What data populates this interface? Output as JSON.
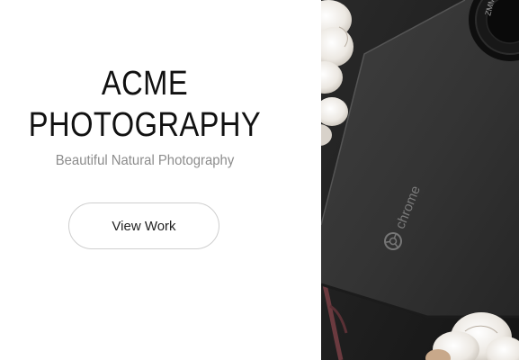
{
  "brand": {
    "line1": "ACME",
    "line2": "PHOTOGRAPHY",
    "tagline": "Beautiful Natural Photography"
  },
  "cta": {
    "label": "View Work"
  },
  "hero": {
    "device_label": "chrome",
    "icon": "chrome-logo-icon"
  }
}
